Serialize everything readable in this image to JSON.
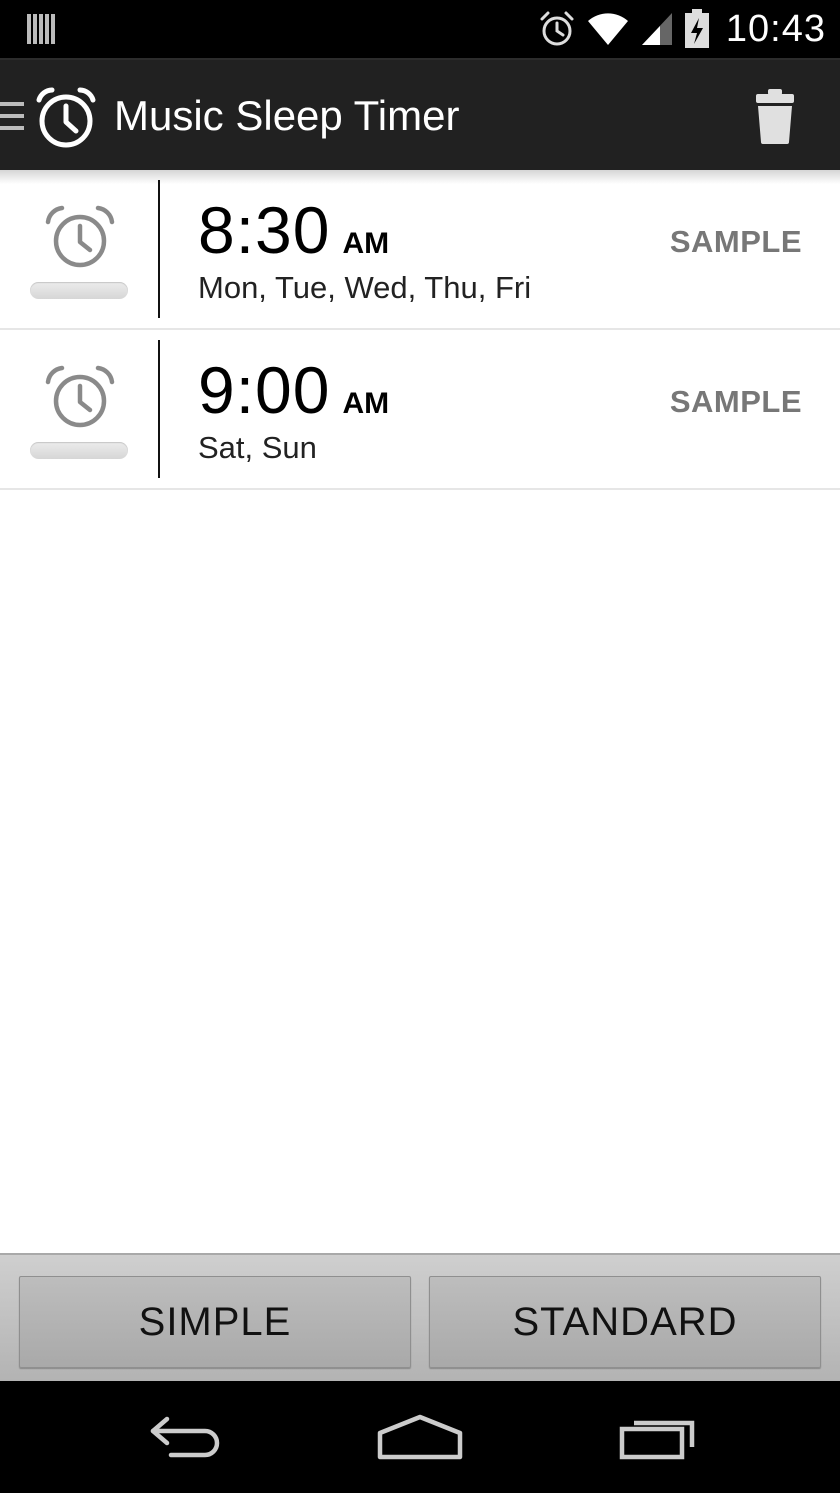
{
  "status_bar": {
    "time": "10:43",
    "icons": [
      "barcode-icon",
      "alarm-status-icon",
      "wifi-icon",
      "signal-icon",
      "battery-charging-icon"
    ]
  },
  "action_bar": {
    "title": "Music Sleep Timer",
    "icons": [
      "drawer-icon",
      "alarm-clock-icon",
      "trash-icon"
    ]
  },
  "alarms": [
    {
      "time": "8:30",
      "ampm": "AM",
      "days": "Mon, Tue, Wed, Thu, Fri",
      "label": "SAMPLE",
      "enabled": false
    },
    {
      "time": "9:00",
      "ampm": "AM",
      "days": "Sat, Sun",
      "label": "SAMPLE",
      "enabled": false
    }
  ],
  "buttons": {
    "simple": "SIMPLE",
    "standard": "STANDARD"
  },
  "nav_bar": {
    "icons": [
      "back-icon",
      "home-icon",
      "recents-icon"
    ]
  },
  "colors": {
    "action_bar_bg": "#212121",
    "label_gray": "#777777",
    "button_bar_bg": "#bdbdbd"
  }
}
